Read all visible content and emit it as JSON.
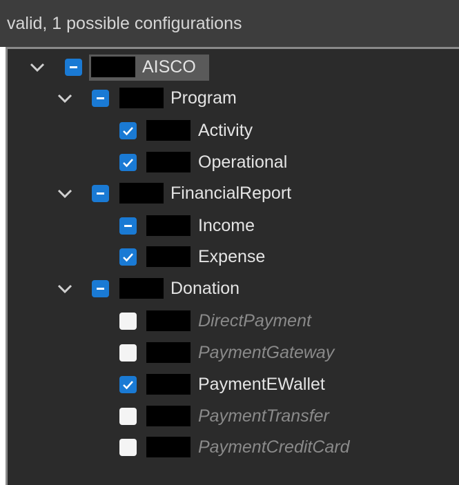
{
  "status": {
    "text": "valid, 1 possible configurations"
  },
  "colors": {
    "checkbox_blue": "#1a7ad4",
    "checkbox_white": "#f4f4f4",
    "panel_bg": "#2b2b2b",
    "status_bg": "#3d3d3d",
    "label_active": "#e4e4e4",
    "label_inactive": "#8a8a8a"
  },
  "tree": {
    "root": {
      "label": "AISCO",
      "state": "partial",
      "expanded": true,
      "icon": "chevron-down-icon"
    },
    "groups": [
      {
        "label": "Program",
        "state": "partial",
        "expanded": true,
        "children": [
          {
            "label": "Activity",
            "state": "checked"
          },
          {
            "label": "Operational",
            "state": "checked"
          }
        ]
      },
      {
        "label": "FinancialReport",
        "state": "partial",
        "expanded": true,
        "children": [
          {
            "label": "Income",
            "state": "partial"
          },
          {
            "label": "Expense",
            "state": "checked"
          }
        ]
      },
      {
        "label": "Donation",
        "state": "partial",
        "expanded": true,
        "children": [
          {
            "label": "DirectPayment",
            "state": "unchecked"
          },
          {
            "label": "PaymentGateway",
            "state": "unchecked"
          },
          {
            "label": "PaymentEWallet",
            "state": "checked"
          },
          {
            "label": "PaymentTransfer",
            "state": "unchecked"
          },
          {
            "label": "PaymentCreditCard",
            "state": "unchecked"
          }
        ]
      }
    ]
  }
}
